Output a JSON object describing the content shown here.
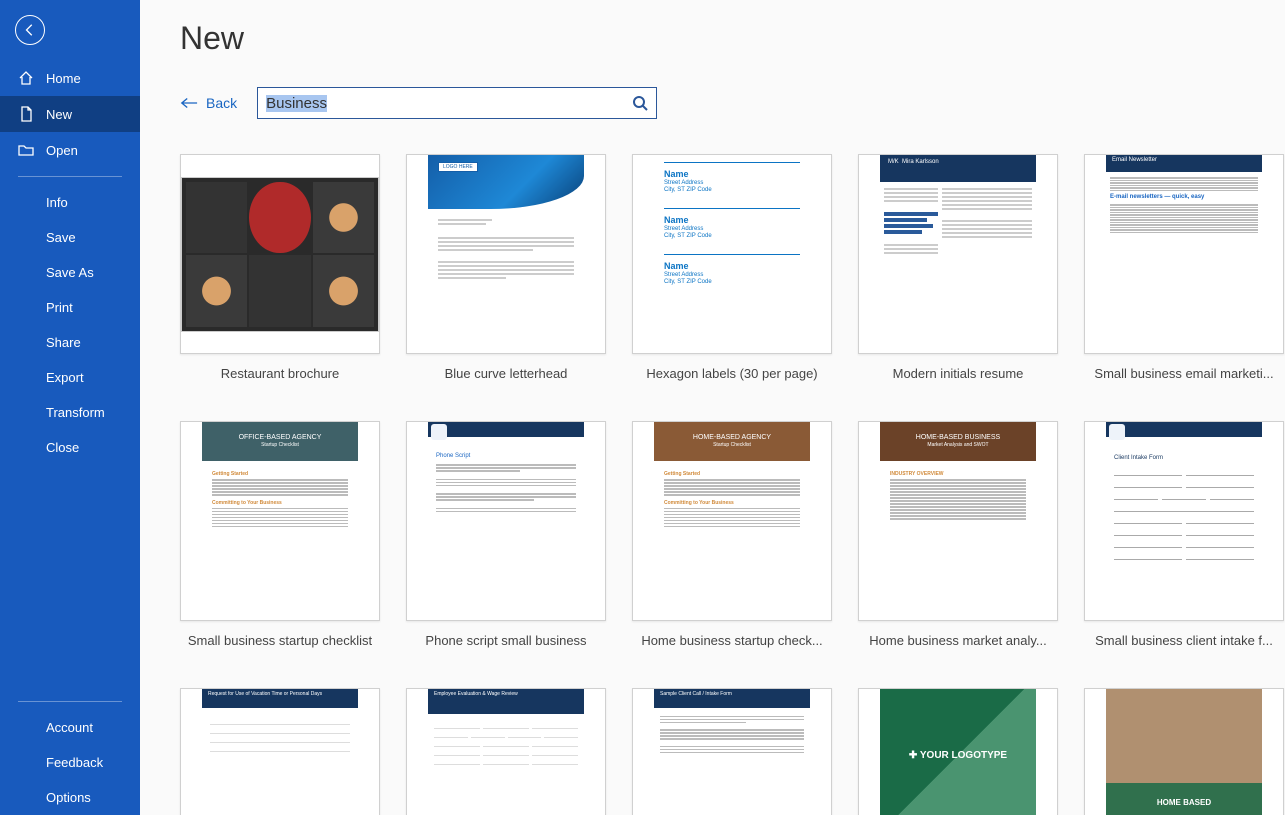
{
  "page_title": "New",
  "back_link": "Back",
  "search_value": "Business",
  "sidebar": {
    "home": "Home",
    "new": "New",
    "open": "Open",
    "info": "Info",
    "save": "Save",
    "save_as": "Save As",
    "print": "Print",
    "share": "Share",
    "export": "Export",
    "transform": "Transform",
    "close": "Close",
    "account": "Account",
    "feedback": "Feedback",
    "options": "Options"
  },
  "templates": [
    {
      "label": "Restaurant brochure"
    },
    {
      "label": "Blue curve letterhead"
    },
    {
      "label": "Hexagon labels (30 per page)"
    },
    {
      "label": "Modern initials resume"
    },
    {
      "label": "Small business email marketi..."
    },
    {
      "label": "Small business startup checklist"
    },
    {
      "label": "Phone script small business"
    },
    {
      "label": "Home business startup check..."
    },
    {
      "label": "Home business market analy..."
    },
    {
      "label": "Small business client intake f..."
    },
    {
      "label": ""
    },
    {
      "label": ""
    },
    {
      "label": ""
    },
    {
      "label": ""
    },
    {
      "label": ""
    }
  ],
  "thumb_text": {
    "bluecurve_logo": "LOGO HERE",
    "hex_name": "Name",
    "hex_addr1": "Street Address",
    "hex_addr2": "City, ST ZIP Code",
    "resume_initials": "M/K",
    "resume_name": "Mira Karlsson",
    "news_title": "Email Newsletter",
    "news_h1": "E-mail newsletters — quick, easy",
    "agency_office": "OFFICE-BASED AGENCY",
    "agency_sub": "Startup Checklist",
    "agency_home": "HOME-BASED AGENCY",
    "agency_biz": "HOME-BASED BUSINESS",
    "agency_biz_sub": "Market Analysis and SWOT",
    "phone_title": "Phone Script",
    "form_title": "Client Intake Form",
    "vac_title": "Request for Use of Vacation Time or Personal Days",
    "eval_title": "Employee Evaluation & Wage Review",
    "client_title": "Sample Client Call / Intake Form",
    "green_logo": "✚ YOUR LOGOTYPE",
    "home_based": "HOME BASED",
    "getting_started": "Getting Started",
    "committing": "Committing to Your Business",
    "industry": "INDUSTRY OVERVIEW"
  }
}
